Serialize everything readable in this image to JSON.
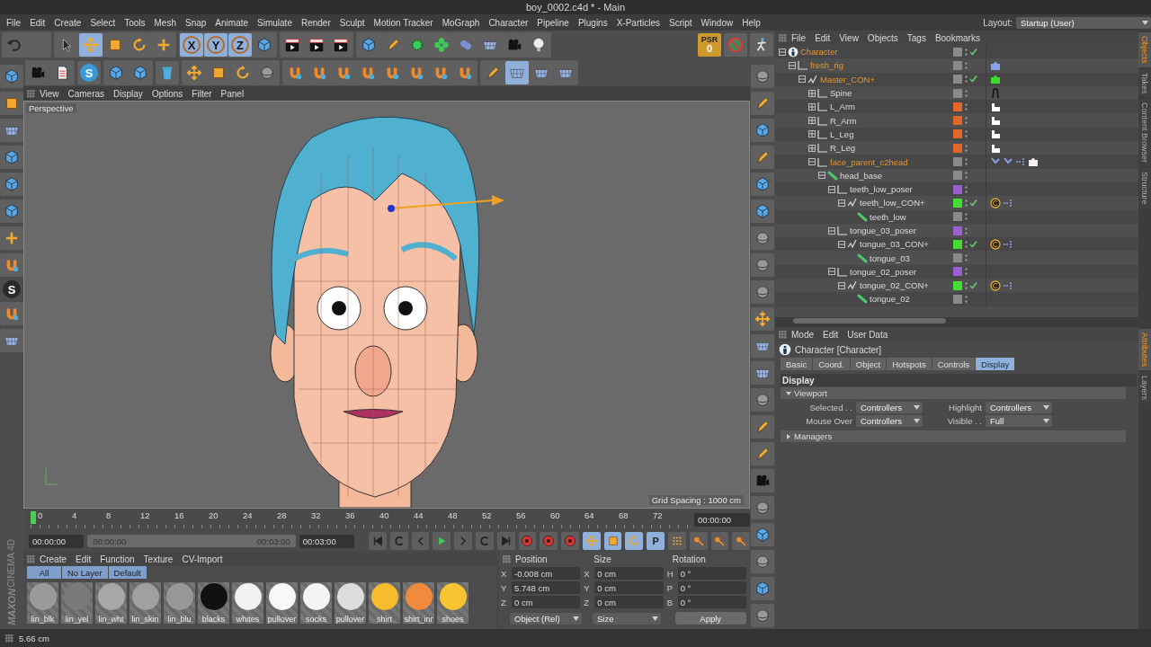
{
  "window": {
    "title": "boy_0002.c4d * - Main"
  },
  "menu_bar": {
    "items": [
      "File",
      "Edit",
      "Create",
      "Select",
      "Tools",
      "Mesh",
      "Snap",
      "Animate",
      "Simulate",
      "Render",
      "Sculpt",
      "Motion Tracker",
      "MoGraph",
      "Character",
      "Pipeline",
      "Plugins",
      "X-Particles",
      "Script",
      "Window",
      "Help"
    ],
    "layout_label": "Layout:",
    "layout_value": "Startup (User)"
  },
  "toolbar": {
    "tools": [
      {
        "selected": false
      },
      {
        "selected": true
      },
      {
        "selected": false
      },
      {
        "selected": false
      },
      {
        "selected": false
      }
    ],
    "axis_lock": [
      {
        "label": "X",
        "on": true
      },
      {
        "label": "Y",
        "on": true
      },
      {
        "label": "Z",
        "on": true
      }
    ],
    "psr_label": "PSR",
    "psr_value": "0",
    "snap_label": "S"
  },
  "left_tools": {
    "snap_label": "S"
  },
  "viewport": {
    "menu": [
      "View",
      "Cameras",
      "Display",
      "Options",
      "Filter",
      "Panel"
    ],
    "camera": "Perspective",
    "grid_spacing": "Grid Spacing : 1000 cm"
  },
  "timeline": {
    "ticks": [
      "0",
      "4",
      "8",
      "12",
      "16",
      "20",
      "24",
      "28",
      "32",
      "36",
      "40",
      "44",
      "48",
      "52",
      "56",
      "60",
      "64",
      "68",
      "72"
    ],
    "current_time": "00:00:00"
  },
  "transport": {
    "start": "00:00:00",
    "range_start": "00:00:00",
    "range_end": "00:03:00",
    "level": 1,
    "end": "00:03:00",
    "modes": [
      {
        "selected": true
      },
      {
        "selected": true
      },
      {
        "selected": true
      }
    ],
    "key_label": "P",
    "key_selected": true
  },
  "material_manager": {
    "menu": [
      "Create",
      "Edit",
      "Function",
      "Texture",
      "CV-Import"
    ],
    "filters": [
      {
        "label": "All",
        "selected": true
      },
      {
        "label": "No Layer",
        "selected": true
      },
      {
        "label": "Default",
        "selected": true
      }
    ],
    "materials": [
      {
        "name": "lin_blk",
        "color": "#9a9a9a"
      },
      {
        "name": "lin_yel",
        "color": "#7a7a7a"
      },
      {
        "name": "lin_wht",
        "color": "#a8a8a8"
      },
      {
        "name": "lin_skin",
        "color": "#a0a0a0"
      },
      {
        "name": "lin_blu",
        "color": "#989898"
      },
      {
        "name": "blacks",
        "color": "#111111"
      },
      {
        "name": "whites",
        "color": "#f2f2f2"
      },
      {
        "name": "pullover",
        "color": "#f8f8f8"
      },
      {
        "name": "socks",
        "color": "#f5f5f5"
      },
      {
        "name": "pullover",
        "color": "#dcdcdc"
      },
      {
        "name": "shirt",
        "color": "#f7bb2e"
      },
      {
        "name": "shirt_inr",
        "color": "#f08a3c"
      },
      {
        "name": "shoes",
        "color": "#f9c431"
      }
    ]
  },
  "coordinates": {
    "headers": [
      "Position",
      "Size",
      "Rotation"
    ],
    "rows": [
      {
        "cells": [
          {
            "axis": "X",
            "value": "-0.008 cm"
          },
          {
            "axis": "X",
            "value": "0 cm"
          },
          {
            "axis": "H",
            "value": "0 °"
          }
        ]
      },
      {
        "cells": [
          {
            "axis": "Y",
            "value": "5.748 cm"
          },
          {
            "axis": "Y",
            "value": "0 cm"
          },
          {
            "axis": "P",
            "value": "0 °"
          }
        ]
      },
      {
        "cells": [
          {
            "axis": "Z",
            "value": "0 cm"
          },
          {
            "axis": "Z",
            "value": "0 cm"
          },
          {
            "axis": "B",
            "value": "0 °"
          }
        ]
      }
    ],
    "mode": "Object (Rel)",
    "size_mode": "Size",
    "apply": "Apply"
  },
  "logo": {
    "line_1": "MAXON",
    "line_2": "CINEMA 4D"
  },
  "object_manager": {
    "menu": [
      "File",
      "Edit",
      "View",
      "Objects",
      "Tags",
      "Bookmarks"
    ],
    "tree": [
      {
        "name": "Character",
        "kind": "character",
        "selected": true,
        "expanded": true,
        "color": "#8a8a8a",
        "checked": true,
        "children": [
          {
            "name": "fresh_rig",
            "kind": "null",
            "selected": true,
            "expanded": true,
            "color": "#8a8a8a",
            "checked": false,
            "tags": [
              {
                "kind": "puzzle-blue"
              }
            ],
            "children": [
              {
                "name": "Master_CON+",
                "kind": "spline",
                "selected": true,
                "expanded": true,
                "color": "#8a8a8a",
                "checked": true,
                "tags": [
                  {
                    "kind": "puzzle-green"
                  }
                ],
                "children": [
                  {
                    "name": "Spine",
                    "kind": "null",
                    "selected": false,
                    "expanded": false,
                    "color": "#8a8a8a",
                    "checked": false,
                    "tags": [
                      {
                        "kind": "spine"
                      }
                    ]
                  },
                  {
                    "name": "L_Arm",
                    "kind": "null",
                    "selected": false,
                    "expanded": false,
                    "color": "#e0692a",
                    "checked": false,
                    "tags": [
                      {
                        "kind": "limb"
                      }
                    ]
                  },
                  {
                    "name": "R_Arm",
                    "kind": "null",
                    "selected": false,
                    "expanded": false,
                    "color": "#e0692a",
                    "checked": false,
                    "tags": [
                      {
                        "kind": "limb"
                      }
                    ]
                  },
                  {
                    "name": "L_Leg",
                    "kind": "null",
                    "selected": false,
                    "expanded": false,
                    "color": "#e0692a",
                    "checked": false,
                    "tags": [
                      {
                        "kind": "limb"
                      }
                    ]
                  },
                  {
                    "name": "R_Leg",
                    "kind": "null",
                    "selected": false,
                    "expanded": false,
                    "color": "#e0692a",
                    "checked": false,
                    "tags": [
                      {
                        "kind": "limb"
                      }
                    ]
                  },
                  {
                    "name": "face_parent_c2head",
                    "kind": "null",
                    "selected": true,
                    "expanded": true,
                    "color": "#8a8a8a",
                    "checked": false,
                    "tags": [
                      {
                        "kind": "ik"
                      },
                      {
                        "kind": "ik"
                      },
                      {
                        "kind": "dots"
                      },
                      {
                        "kind": "puzzle-white"
                      }
                    ],
                    "children": [
                      {
                        "name": "head_base",
                        "kind": "bone",
                        "selected": false,
                        "expanded": true,
                        "color": "#8a8a8a",
                        "checked": false,
                        "children": [
                          {
                            "name": "teeth_low_poser",
                            "kind": "null",
                            "selected": false,
                            "expanded": true,
                            "color": "#9a5fd0",
                            "checked": false,
                            "children": [
                              {
                                "name": "teeth_low_CON+",
                                "kind": "spline",
                                "selected": false,
                                "expanded": true,
                                "color": "#44dd33",
                                "checked": true,
                                "tags": [
                                  {
                                    "kind": "constraint"
                                  },
                                  {
                                    "kind": "dots"
                                  }
                                ],
                                "children": [
                                  {
                                    "name": "teeth_low",
                                    "kind": "bone",
                                    "selected": false,
                                    "color": "#8a8a8a",
                                    "checked": false
                                  }
                                ]
                              }
                            ]
                          },
                          {
                            "name": "tongue_03_poser",
                            "kind": "null",
                            "selected": false,
                            "expanded": true,
                            "color": "#9a5fd0",
                            "checked": false,
                            "children": [
                              {
                                "name": "tongue_03_CON+",
                                "kind": "spline",
                                "selected": false,
                                "expanded": true,
                                "color": "#44dd33",
                                "checked": true,
                                "tags": [
                                  {
                                    "kind": "constraint"
                                  },
                                  {
                                    "kind": "dots"
                                  }
                                ],
                                "children": [
                                  {
                                    "name": "tongue_03",
                                    "kind": "bone",
                                    "selected": false,
                                    "color": "#8a8a8a",
                                    "checked": false
                                  }
                                ]
                              }
                            ]
                          },
                          {
                            "name": "tongue_02_poser",
                            "kind": "null",
                            "selected": false,
                            "expanded": true,
                            "color": "#9a5fd0",
                            "checked": false,
                            "children": [
                              {
                                "name": "tongue_02_CON+",
                                "kind": "spline",
                                "selected": false,
                                "expanded": true,
                                "color": "#44dd33",
                                "checked": true,
                                "tags": [
                                  {
                                    "kind": "constraint"
                                  },
                                  {
                                    "kind": "dots"
                                  }
                                ],
                                "children": [
                                  {
                                    "name": "tongue_02",
                                    "kind": "bone",
                                    "selected": false,
                                    "color": "#8a8a8a",
                                    "checked": false
                                  }
                                ]
                              }
                            ]
                          }
                        ]
                      }
                    ]
                  }
                ]
              }
            ]
          }
        ]
      }
    ]
  },
  "side_tabs_top": [
    {
      "label": "Objects",
      "selected": true
    },
    {
      "label": "Takes",
      "selected": false
    },
    {
      "label": "Content Browser",
      "selected": false
    },
    {
      "label": "Structure",
      "selected": false
    }
  ],
  "attributes": {
    "menu": [
      "Mode",
      "Edit",
      "User Data"
    ],
    "object": "Character [Character]",
    "tabs": [
      {
        "label": "Basic",
        "selected": false
      },
      {
        "label": "Coord.",
        "selected": false
      },
      {
        "label": "Object",
        "selected": false
      },
      {
        "label": "Hotspots",
        "selected": false
      },
      {
        "label": "Controls",
        "selected": false
      },
      {
        "label": "Display",
        "selected": true
      }
    ],
    "section": "Display",
    "groups": [
      {
        "label": "Viewport",
        "expanded": true,
        "fields": [
          {
            "label": "Selected . .",
            "value": "Controllers"
          },
          {
            "label": "Highlight",
            "value": "Controllers"
          },
          {
            "label": "Mouse Over",
            "value": "Controllers"
          },
          {
            "label": "Visible . .",
            "value": "Full"
          }
        ]
      },
      {
        "label": "Managers",
        "expanded": false
      }
    ]
  },
  "side_tabs_bottom": [
    {
      "label": "Attributes",
      "selected": true
    },
    {
      "label": "Layers",
      "selected": false
    }
  ],
  "status_bar": {
    "text": "5.66 cm"
  }
}
